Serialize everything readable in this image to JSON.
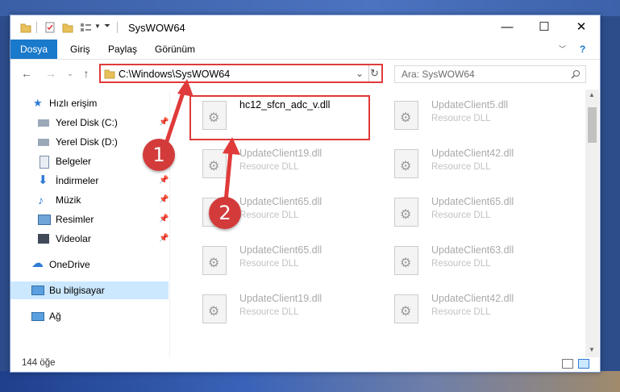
{
  "window": {
    "title": "SysWOW64"
  },
  "ribbon": {
    "tabs": [
      "Dosya",
      "Giriş",
      "Paylaş",
      "Görünüm"
    ]
  },
  "address": {
    "path": "C:\\Windows\\SysWOW64"
  },
  "search": {
    "placeholder": "Ara: SysWOW64"
  },
  "sidebar": {
    "items": [
      {
        "label": "Hızlı erişim",
        "icon": "star-icon"
      },
      {
        "label": "Yerel Disk (C:)",
        "icon": "drive-icon",
        "pinned": true
      },
      {
        "label": "Yerel Disk (D:)",
        "icon": "drive-icon"
      },
      {
        "label": "Belgeler",
        "icon": "documents-icon"
      },
      {
        "label": "İndirmeler",
        "icon": "download-icon",
        "pinned": true
      },
      {
        "label": "Müzik",
        "icon": "music-icon",
        "pinned": true
      },
      {
        "label": "Resimler",
        "icon": "pictures-icon",
        "pinned": true
      },
      {
        "label": "Videolar",
        "icon": "videos-icon",
        "pinned": true
      },
      {
        "label": "OneDrive",
        "icon": "cloud-icon"
      },
      {
        "label": "Bu bilgisayar",
        "icon": "computer-icon",
        "selected": true
      },
      {
        "label": "Ağ",
        "icon": "network-icon"
      }
    ]
  },
  "files": [
    {
      "name": "hc12_sfcn_adc_v.dll",
      "desc": ""
    },
    {
      "name": "UpdateClient5.dll",
      "desc": "Resource DLL"
    },
    {
      "name": "UpdateClient19.dll",
      "desc": "Resource DLL"
    },
    {
      "name": "UpdateClient42.dll",
      "desc": "Resource DLL"
    },
    {
      "name": "UpdateClient65.dll",
      "desc": "Resource DLL"
    },
    {
      "name": "UpdateClient65.dll",
      "desc": "Resource DLL"
    },
    {
      "name": "UpdateClient65.dll",
      "desc": "Resource DLL"
    },
    {
      "name": "UpdateClient63.dll",
      "desc": "Resource DLL"
    },
    {
      "name": "UpdateClient19.dll",
      "desc": "Resource DLL"
    },
    {
      "name": "UpdateClient42.dll",
      "desc": "Resource DLL"
    }
  ],
  "status": {
    "count": "144 öğe"
  },
  "annotations": {
    "step1": "1",
    "step2": "2"
  },
  "colors": {
    "accent": "#1979ca",
    "highlight": "#e03a3a",
    "badge": "#d33b3b"
  }
}
